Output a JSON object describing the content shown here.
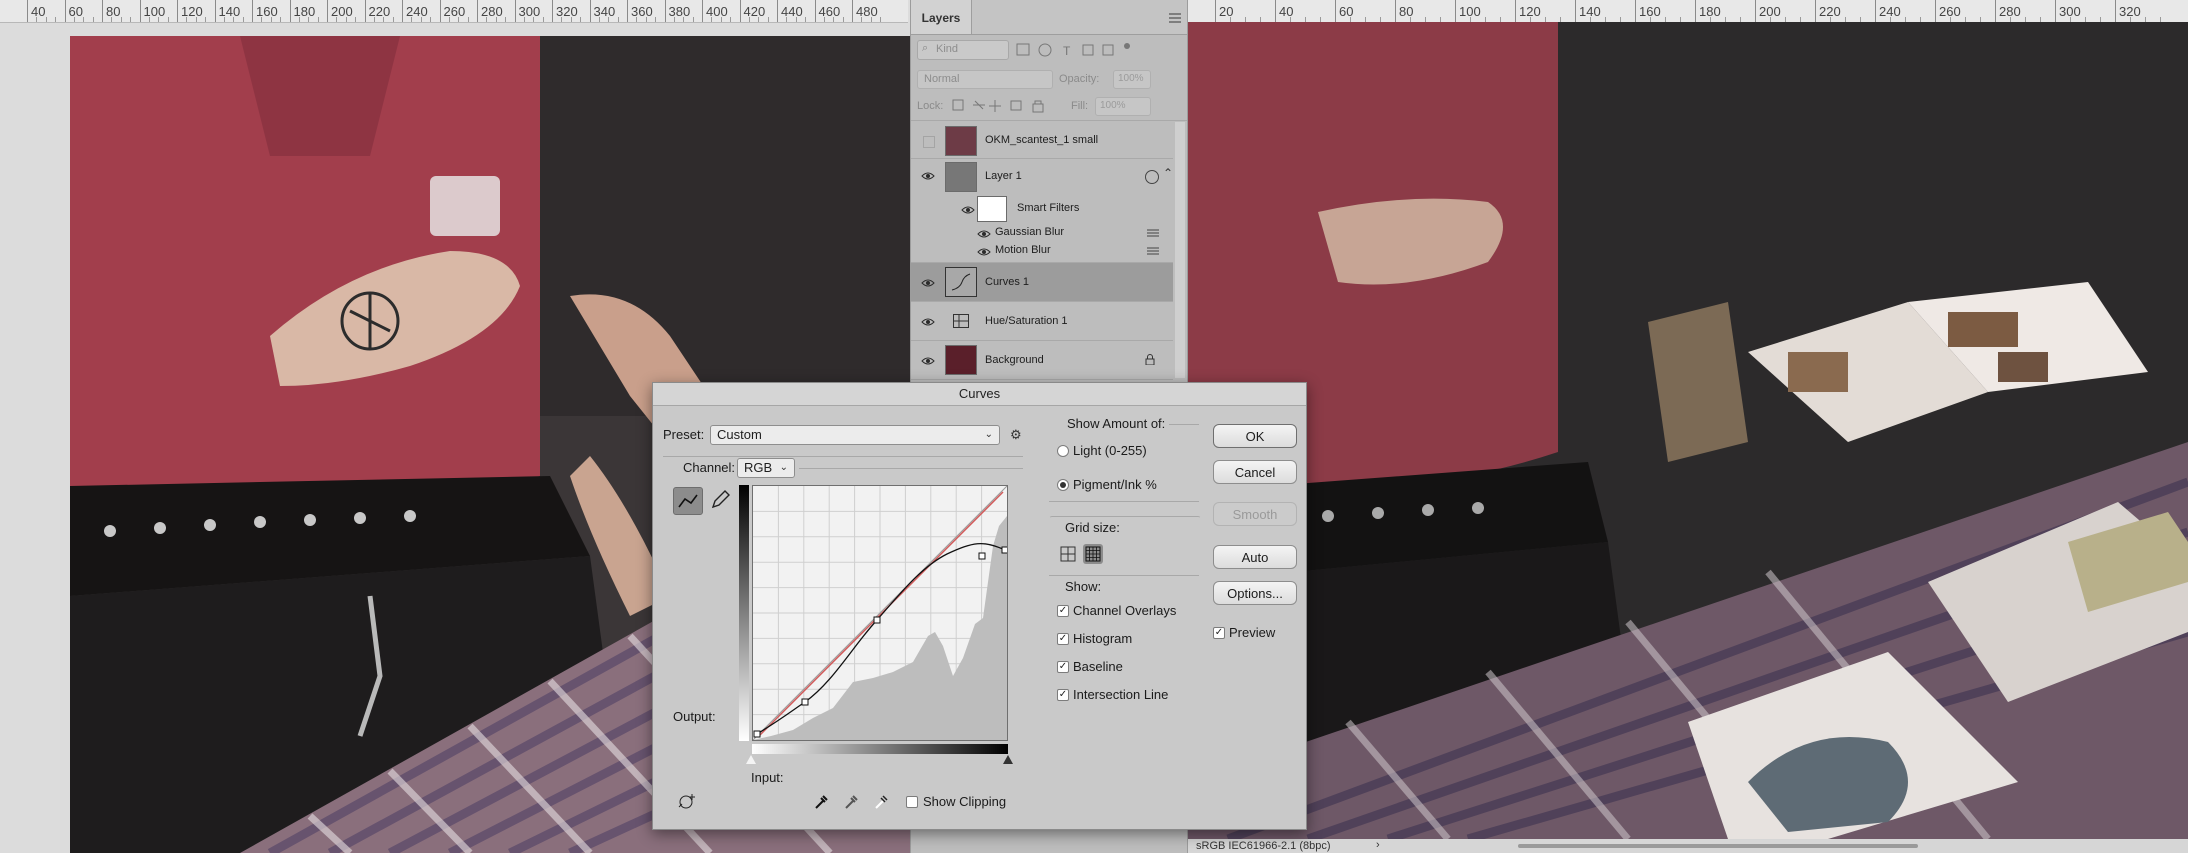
{
  "rulers": {
    "left_ticks": [
      "40",
      "60",
      "80",
      "100",
      "120",
      "140",
      "160",
      "180",
      "200",
      "220",
      "240",
      "260",
      "280",
      "300",
      "320",
      "340",
      "360",
      "380",
      "400",
      "420",
      "440",
      "460",
      "480"
    ],
    "right_ticks": [
      "20",
      "40",
      "60",
      "80",
      "100",
      "120",
      "140",
      "160",
      "180",
      "200",
      "220",
      "240",
      "260",
      "280",
      "300",
      "320"
    ]
  },
  "layers_panel": {
    "tab": "Layers",
    "filter_label": "Kind",
    "blend_mode": "Normal",
    "opacity_label": "Opacity:",
    "opacity_value": "100%",
    "lock_label": "Lock:",
    "fill_label": "Fill:",
    "fill_value": "100%",
    "layers": [
      {
        "name": "OKM_scantest_1 small",
        "visible": false
      },
      {
        "name": "Layer 1",
        "visible": true
      },
      {
        "name": "Smart Filters",
        "visible": true
      },
      {
        "name": "Gaussian Blur",
        "visible": true
      },
      {
        "name": "Motion Blur",
        "visible": true
      },
      {
        "name": "Curves 1",
        "visible": true,
        "selected": true
      },
      {
        "name": "Hue/Saturation 1",
        "visible": true
      },
      {
        "name": "Background",
        "visible": true,
        "locked": true
      }
    ]
  },
  "curves_dialog": {
    "title": "Curves",
    "preset_label": "Preset:",
    "preset_value": "Custom",
    "channel_label": "Channel:",
    "channel_value": "RGB",
    "output_label": "Output:",
    "input_label": "Input:",
    "show_clipping_label": "Show Clipping",
    "show_clipping": false,
    "show_amount_label": "Show Amount of:",
    "light_label": "Light  (0-255)",
    "pigment_label": "Pigment/Ink %",
    "show_amount_selected": "Pigment/Ink %",
    "grid_size_label": "Grid size:",
    "show_label": "Show:",
    "show_options": [
      {
        "label": "Channel Overlays",
        "checked": true
      },
      {
        "label": "Histogram",
        "checked": true
      },
      {
        "label": "Baseline",
        "checked": true
      },
      {
        "label": "Intersection Line",
        "checked": true
      }
    ],
    "buttons": {
      "ok": "OK",
      "cancel": "Cancel",
      "smooth": "Smooth",
      "auto": "Auto",
      "options": "Options..."
    },
    "preview_label": "Preview",
    "preview": true
  },
  "status_bar": {
    "profile": "sRGB IEC61966-2.1 (8bpc)",
    "arrow": "›"
  }
}
